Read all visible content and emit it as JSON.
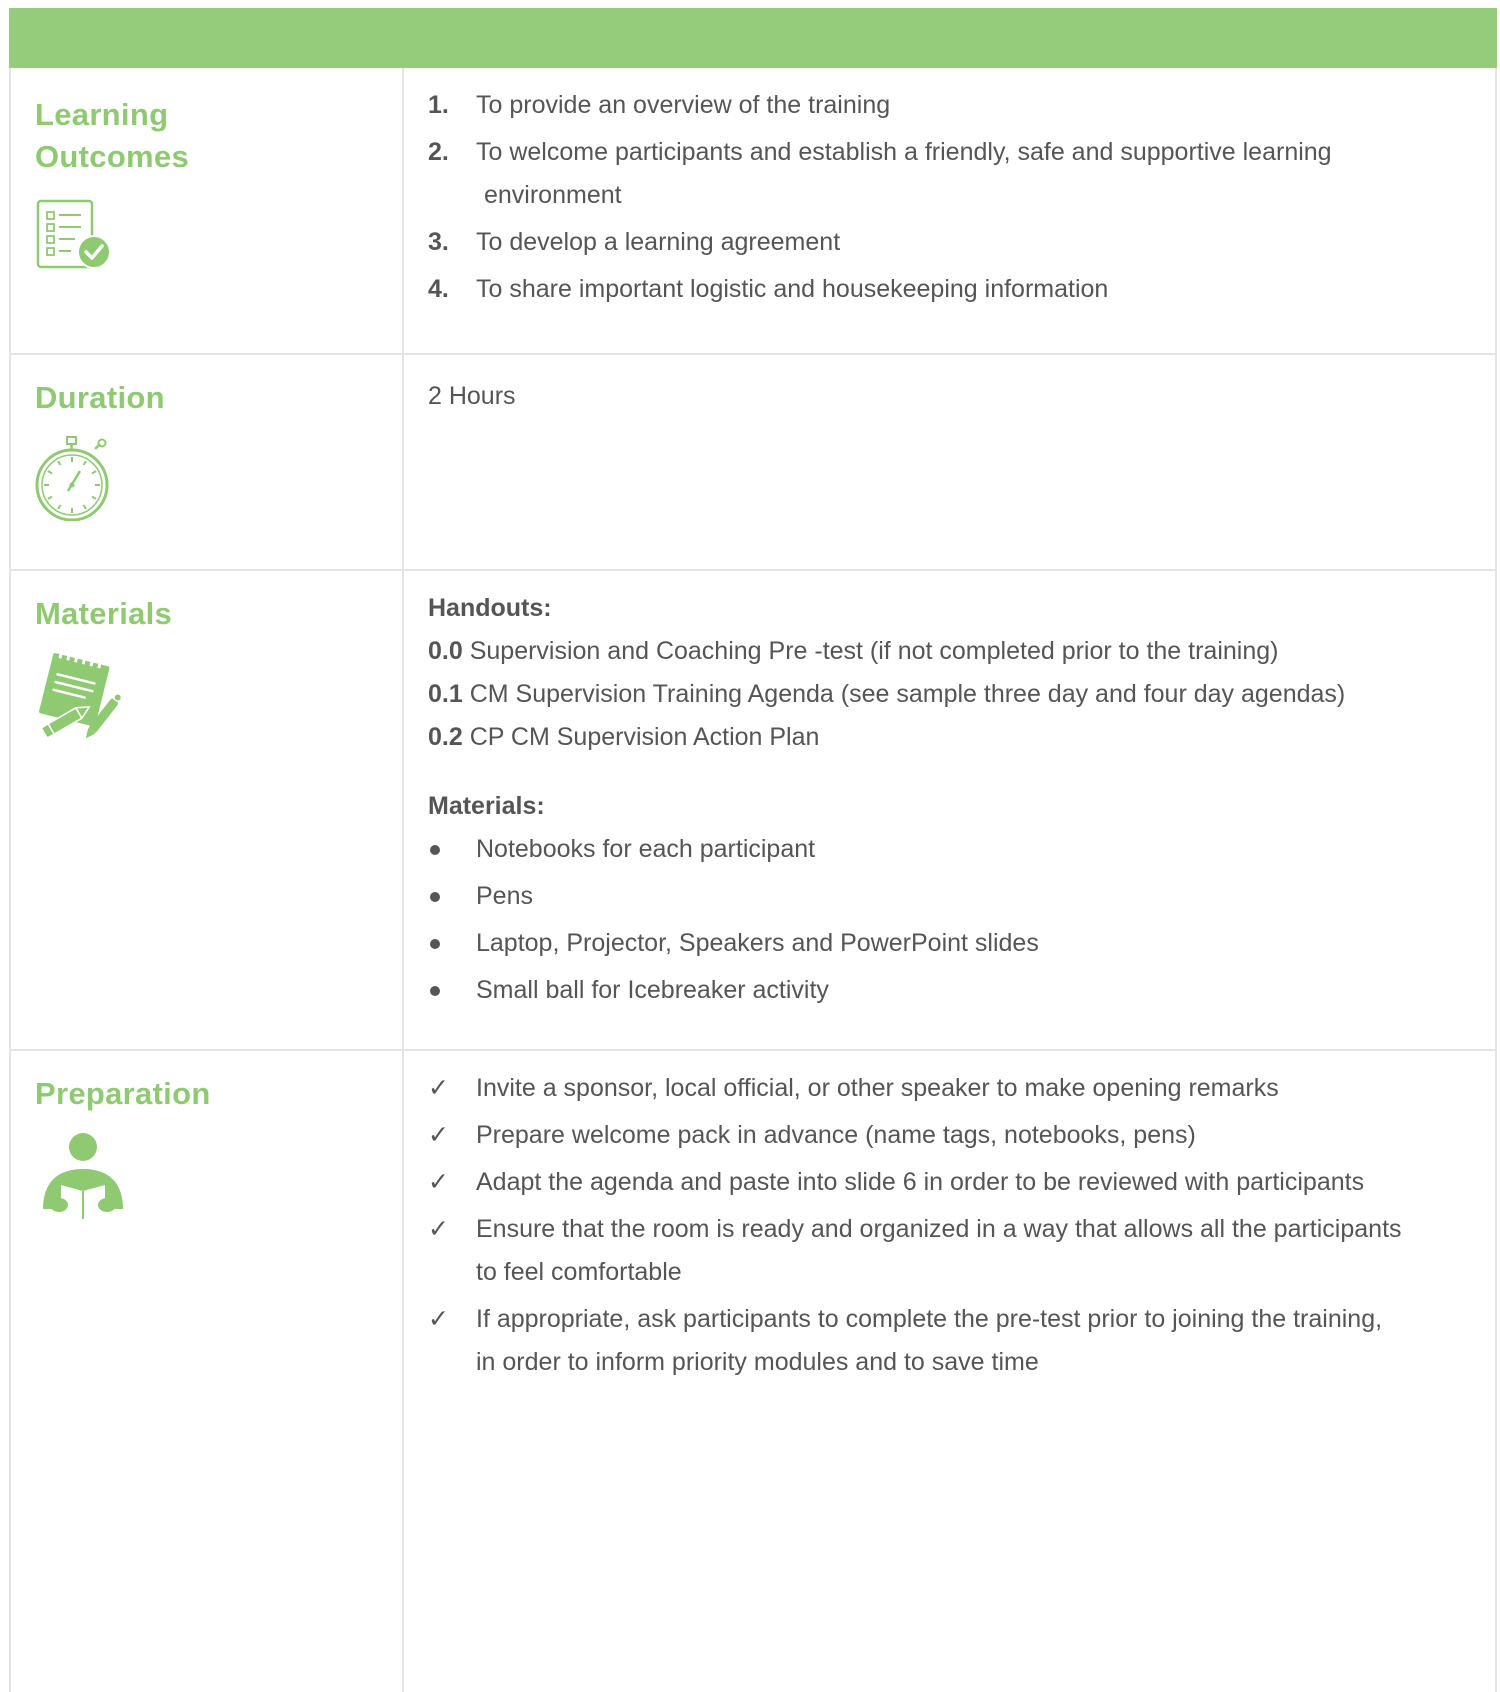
{
  "colors": {
    "accent_green": "#95cc7c",
    "label_green": "#8fca73",
    "text_gray": "#555555",
    "border_gray": "#e4e4e4"
  },
  "rows": {
    "learning_outcomes": {
      "label_line1": "Learning",
      "label_line2": "Outcomes",
      "icon": "checklist-icon",
      "items": [
        {
          "marker": "1.",
          "text": "To provide an overview of the training"
        },
        {
          "marker": "2.",
          "text": "To welcome participants and establish a friendly, safe and supportive learning",
          "continuation": "environment"
        },
        {
          "marker": "3.",
          "text": "To develop a learning agreement"
        },
        {
          "marker": "4.",
          "text": "To share important logistic and housekeeping information"
        }
      ]
    },
    "duration": {
      "label": "Duration",
      "icon": "stopwatch-icon",
      "value": "2 Hours"
    },
    "materials": {
      "label": "Materials",
      "icon": "notepad-pencil-icon",
      "handouts_heading": "Handouts:",
      "handouts": [
        {
          "code": "0.0",
          "text": " Supervision and Coaching Pre -test (if not completed prior to the training)"
        },
        {
          "code": "0.1",
          "text": " CM Supervision Training Agenda (see sample three day and four day agendas)"
        },
        {
          "code": "0.2",
          "text": " CP CM Supervision Action Plan"
        }
      ],
      "materials_heading": "Materials:",
      "materials": [
        "Notebooks for each participant",
        "Pens",
        "Laptop, Projector, Speakers and PowerPoint slides",
        "Small ball for Icebreaker activity"
      ]
    },
    "preparation": {
      "label": "Preparation",
      "icon": "person-reading-icon",
      "checkmark": "✓",
      "items": [
        {
          "text": "Invite a sponsor, local official, or other speaker to make opening remarks"
        },
        {
          "text": "Prepare welcome pack in advance (name tags, notebooks, pens)"
        },
        {
          "text": "Adapt the agenda and paste into slide 6 in order to be reviewed with participants"
        },
        {
          "text": "Ensure that the room is ready and organized in a way that allows all the participants",
          "continuation": "to feel comfortable"
        },
        {
          "text": "If appropriate, ask participants to complete the pre-test prior to joining the training,",
          "continuation": "in order to inform priority modules and to save time"
        }
      ]
    }
  }
}
